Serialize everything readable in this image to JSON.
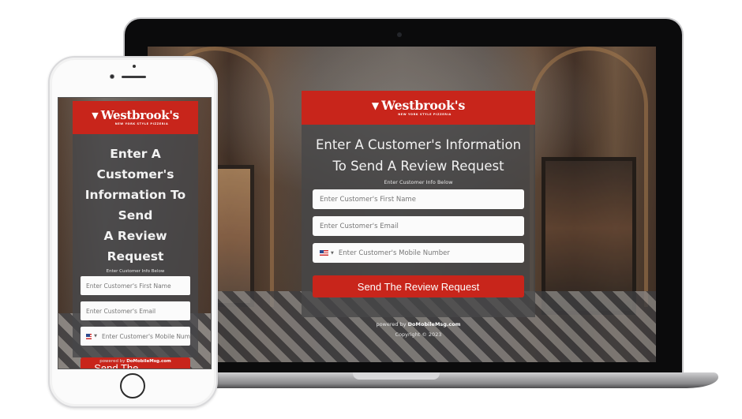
{
  "brand": {
    "name": "Westbrook's",
    "tagline": "NEW YORK STYLE PIZZERIA",
    "icon": "pizza-slice-icon",
    "accent_color": "#c8251b"
  },
  "form": {
    "headline": "Enter A Customer's Information To Send A Review Request",
    "headline_desktop_lines": [
      "Enter A Customer's Information",
      "To Send A Review Request"
    ],
    "headline_mobile_lines": [
      "Enter A Customer's",
      "Information To Send",
      "A Review Request"
    ],
    "sublabel": "Enter Customer Info Below",
    "fields": {
      "first_name": {
        "placeholder": "Enter Customer's First Name",
        "value": ""
      },
      "email": {
        "placeholder": "Enter Customer's Email",
        "value": ""
      },
      "mobile": {
        "placeholder": "Enter Customer's Mobile Number",
        "placeholder_mobile_visible": "Enter Customer's Mobile Num",
        "value": "",
        "country": "US",
        "country_icon": "us-flag-icon"
      }
    },
    "submit_label": "Send The Review Request",
    "submit_mobile_lines": [
      "Send The Review",
      "Request"
    ]
  },
  "footer": {
    "powered_by_prefix": "powered by",
    "powered_by_brand": "DoMobileMsg.com",
    "copyright": "Copyright © 2023"
  },
  "devices": [
    "laptop",
    "phone"
  ]
}
